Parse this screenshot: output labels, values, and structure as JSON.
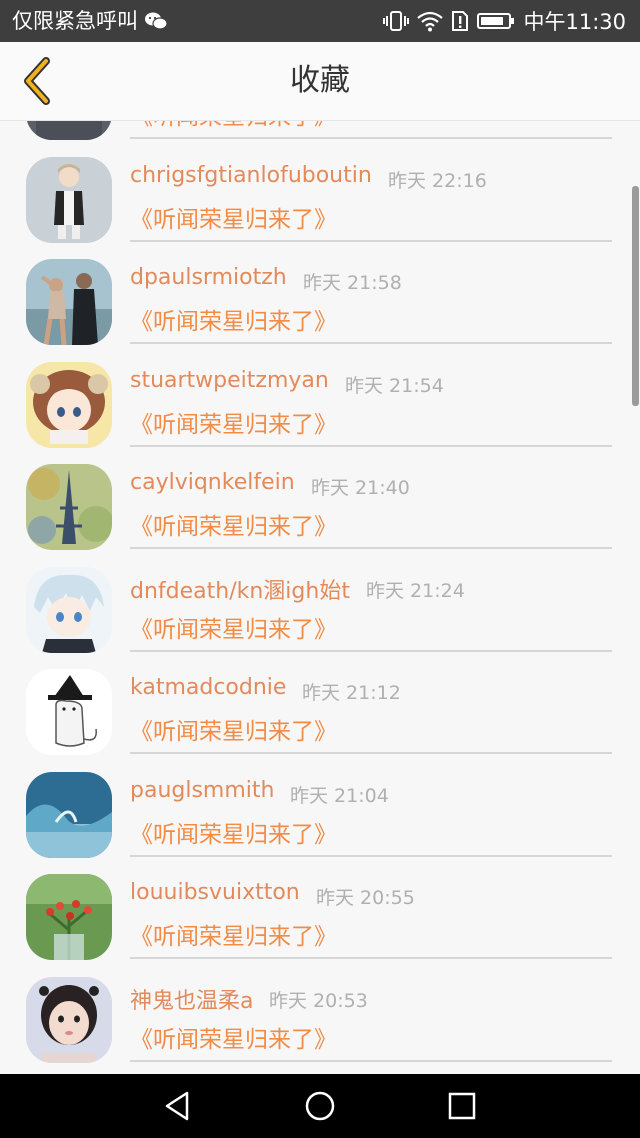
{
  "status_bar": {
    "left_text": "仅限紧急呼叫",
    "time": "中午11:30",
    "icons": [
      "wechat-icon",
      "vibrate-icon",
      "wifi-icon",
      "sim-alert-icon",
      "battery-icon"
    ]
  },
  "header": {
    "title": "收藏",
    "back_icon": "chevron-left-icon",
    "accent_color": "#f0b31e"
  },
  "list": {
    "items": [
      {
        "name": "",
        "time": "",
        "book": "《听闻荣星归来了》",
        "avatar": "partial-avatar"
      },
      {
        "name": "chrigsfgtianlofuboutin",
        "time": "昨天 22:16",
        "book": "《听闻荣星归来了》",
        "avatar": "illustrated-boy-avatar"
      },
      {
        "name": "dpaulsrmiotzh",
        "time": "昨天 21:58",
        "book": "《听闻荣星归来了》",
        "avatar": "dancing-couple-avatar"
      },
      {
        "name": "stuartwpeitzmyan",
        "time": "昨天 21:54",
        "book": "《听闻荣星归来了》",
        "avatar": "anime-girl-avatar"
      },
      {
        "name": "caylviqnkelfein",
        "time": "昨天 21:40",
        "book": "《听闻荣星归来了》",
        "avatar": "eiffel-tower-avatar"
      },
      {
        "name": "dnfdeath/kn溷igh始t",
        "time": "昨天 21:24",
        "book": "《听闻荣星归来了》",
        "avatar": "anime-boy-avatar"
      },
      {
        "name": "katmadcodnie",
        "time": "昨天 21:12",
        "book": "《听闻荣星归来了》",
        "avatar": "witch-cat-avatar"
      },
      {
        "name": "pauglsmmith",
        "time": "昨天 21:04",
        "book": "《听闻荣星归来了》",
        "avatar": "ocean-wave-avatar"
      },
      {
        "name": "louuibsvuixtton",
        "time": "昨天 20:55",
        "book": "《听闻荣星归来了》",
        "avatar": "berry-plant-avatar"
      },
      {
        "name": "神鬼也温柔a",
        "time": "昨天 20:53",
        "book": "《听闻荣星归来了》",
        "avatar": "girl-selfie-avatar"
      }
    ]
  },
  "nav_bar": {
    "icons": [
      "back-triangle-icon",
      "home-circle-icon",
      "recents-square-icon"
    ]
  },
  "colors": {
    "name": "#e38a5a",
    "book": "#f08c46",
    "time": "#b0b0b0",
    "background": "#f8f7f7"
  }
}
